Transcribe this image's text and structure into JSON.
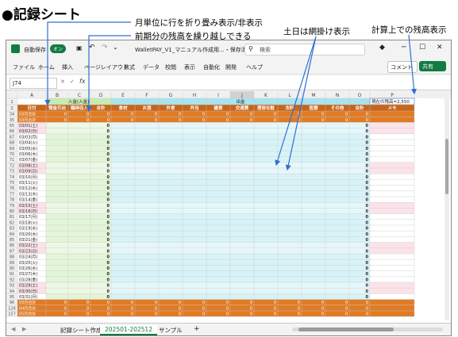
{
  "annotations": {
    "heading": "●記録シート",
    "note1": "月単位に行を折り畳み表示/非表示",
    "note2": "前期分の残高を繰り越しできる",
    "note3": "土日は網掛け表示",
    "note4": "計算上での残高表示"
  },
  "window": {
    "autosave_label": "自動保存",
    "autosave_state": "オン",
    "filename": "WalletPAY_V1_マニュアル作成用...・保存済み",
    "search_placeholder": "検索",
    "comment_btn": "コメント",
    "share_btn": "共有"
  },
  "ribbon_tabs": [
    "ファイル",
    "ホーム",
    "挿入",
    "ページレイアウト",
    "数式",
    "データ",
    "校閲",
    "表示",
    "自動化",
    "開発",
    "ヘルプ"
  ],
  "formula_bar": {
    "name_box": "J74",
    "fx": "fx"
  },
  "columns": [
    "A",
    "B",
    "C",
    "D",
    "E",
    "F",
    "G",
    "H",
    "I",
    "J",
    "K",
    "L",
    "M",
    "N",
    "O",
    "P"
  ],
  "header_row1": {
    "income_group": "入金(入金)",
    "expense_group": "出金",
    "balance_note": "現在の残高=2,550"
  },
  "header_row2": [
    "日付",
    "預金引出",
    "臨時収入",
    "合計",
    "食材",
    "お酒",
    "外食",
    "弁当",
    "雑貨",
    "交通費",
    "理容化粧",
    "衣料",
    "医療",
    "その他",
    "合計",
    "メモ"
  ],
  "rows": [
    {
      "num": "34",
      "label": "03月合計",
      "type": "orange"
    },
    {
      "num": "35",
      "label": "03月合計",
      "type": "orange"
    },
    {
      "num": "65",
      "label": "03/01(土)",
      "type": "weekend"
    },
    {
      "num": "66",
      "label": "03/02(日)",
      "type": "weekend"
    },
    {
      "num": "67",
      "label": "03/03(月)",
      "type": "weekday"
    },
    {
      "num": "68",
      "label": "03/04(火)",
      "type": "weekday"
    },
    {
      "num": "69",
      "label": "03/05(水)",
      "type": "weekday"
    },
    {
      "num": "70",
      "label": "03/06(木)",
      "type": "weekday"
    },
    {
      "num": "71",
      "label": "03/07(金)",
      "type": "weekday"
    },
    {
      "num": "72",
      "label": "03/08(土)",
      "type": "weekend"
    },
    {
      "num": "73",
      "label": "03/09(日)",
      "type": "weekend"
    },
    {
      "num": "74",
      "label": "03/10(月)",
      "type": "weekday"
    },
    {
      "num": "75",
      "label": "03/11(火)",
      "type": "weekday"
    },
    {
      "num": "76",
      "label": "03/12(水)",
      "type": "weekday"
    },
    {
      "num": "77",
      "label": "03/13(木)",
      "type": "weekday"
    },
    {
      "num": "78",
      "label": "03/14(金)",
      "type": "weekday"
    },
    {
      "num": "79",
      "label": "03/15(土)",
      "type": "weekend"
    },
    {
      "num": "80",
      "label": "03/16(日)",
      "type": "weekend"
    },
    {
      "num": "81",
      "label": "03/17(月)",
      "type": "weekday"
    },
    {
      "num": "82",
      "label": "03/18(火)",
      "type": "weekday"
    },
    {
      "num": "83",
      "label": "03/19(水)",
      "type": "weekday"
    },
    {
      "num": "84",
      "label": "03/20(木)",
      "type": "weekday"
    },
    {
      "num": "85",
      "label": "03/21(金)",
      "type": "weekday"
    },
    {
      "num": "86",
      "label": "03/22(土)",
      "type": "weekend"
    },
    {
      "num": "87",
      "label": "03/23(日)",
      "type": "weekend"
    },
    {
      "num": "88",
      "label": "03/24(月)",
      "type": "weekday"
    },
    {
      "num": "89",
      "label": "03/25(火)",
      "type": "weekday"
    },
    {
      "num": "90",
      "label": "03/26(水)",
      "type": "weekday"
    },
    {
      "num": "91",
      "label": "03/27(木)",
      "type": "weekday"
    },
    {
      "num": "92",
      "label": "03/28(金)",
      "type": "weekday"
    },
    {
      "num": "93",
      "label": "03/29(土)",
      "type": "weekend"
    },
    {
      "num": "94",
      "label": "03/30(日)",
      "type": "weekend"
    },
    {
      "num": "95",
      "label": "03/31(月)",
      "type": "weekday"
    },
    {
      "num": "96",
      "label": "03月合計",
      "type": "orange"
    },
    {
      "num": "126",
      "label": "04月合計",
      "type": "orange"
    },
    {
      "num": "157",
      "label": "05月合計",
      "type": "orange"
    }
  ],
  "cell_zero": "0",
  "sheet_tabs": [
    "記録シート作成",
    "202501-202512",
    "サンプル"
  ],
  "active_sheet": "202501-202512",
  "add_sheet": "+",
  "colors": {
    "orange": "#e07b25",
    "orange_dark": "#c8651a",
    "weekend": "#fbe3e8",
    "income_fill": "#e3f5d8",
    "income_header": "#c6ecb4",
    "expense_fill": "#d8f3f7",
    "expense_header": "#a7e4ef",
    "excel_green": "#107c41",
    "arrow": "#2f6fd0"
  }
}
